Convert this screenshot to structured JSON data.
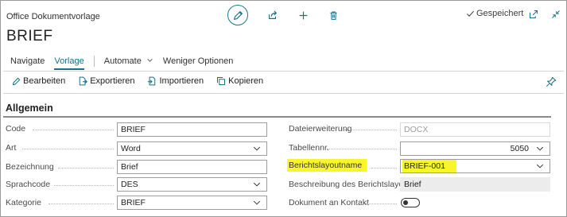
{
  "window": {
    "title": "Office Dokumentvorlage",
    "status": "Gespeichert"
  },
  "page": {
    "title": "BRIEF"
  },
  "toolbar": {
    "edit_icon": "pencil-icon",
    "share_icon": "share-icon",
    "add_icon": "plus-icon",
    "delete_icon": "trash-icon"
  },
  "nav": {
    "items": [
      {
        "label": "Navigate"
      },
      {
        "label": "Vorlage",
        "active": true
      },
      {
        "label": "Automate"
      },
      {
        "label": "Weniger Optionen"
      }
    ]
  },
  "actions": [
    {
      "label": "Bearbeiten",
      "icon": "pencil-icon"
    },
    {
      "label": "Exportieren",
      "icon": "export-icon"
    },
    {
      "label": "Importieren",
      "icon": "import-icon"
    },
    {
      "label": "Kopieren",
      "icon": "copy-icon"
    }
  ],
  "section": {
    "title": "Allgemein"
  },
  "fields_left": [
    {
      "label": "Code",
      "value": "BRIEF",
      "type": "text"
    },
    {
      "label": "Art",
      "value": "Word",
      "type": "select"
    },
    {
      "label": "Bezeichnung",
      "value": "Brief",
      "type": "text"
    },
    {
      "label": "Sprachcode",
      "value": "DES",
      "type": "select"
    },
    {
      "label": "Kategorie",
      "value": "BRIEF",
      "type": "select"
    }
  ],
  "fields_right": [
    {
      "label": "Dateierweiterung",
      "value": "DOCX",
      "type": "readonly"
    },
    {
      "label": "Tabellennr.",
      "value": "5050",
      "type": "select-number"
    },
    {
      "label": "Berichtslayoutname",
      "value": "BRIEF-001",
      "type": "select",
      "highlighted": true,
      "highlight_color": "#f8f52b"
    },
    {
      "label": "Beschreibung des Berichtslayouts",
      "value": "Brief",
      "type": "readonly-grey"
    },
    {
      "label": "Dokument an Kontakt",
      "value": "off",
      "type": "toggle"
    }
  ],
  "colors": {
    "accent": "#1a6f8a",
    "highlight": "#f8f52b"
  }
}
